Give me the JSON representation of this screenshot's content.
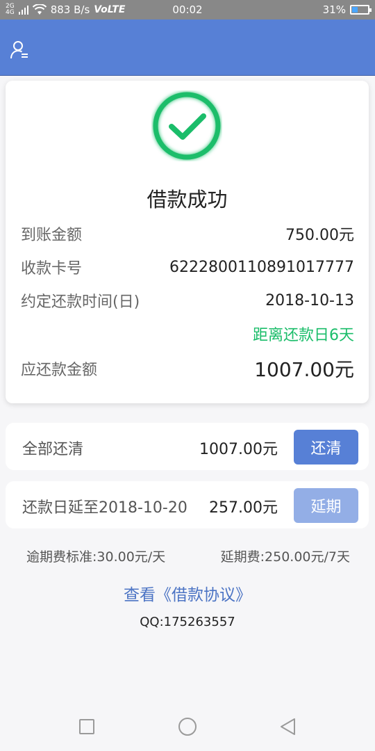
{
  "status_bar": {
    "signal_top": "2G",
    "signal_bottom": "4G",
    "speed": "883 B/s",
    "network": "VoLTE",
    "time": "00:02",
    "battery": "31%"
  },
  "header": {
    "icon": "user-icon",
    "accent_color": "#5780d6"
  },
  "result": {
    "title": "借款成功",
    "icon": "check-circle-icon",
    "icon_color": "#1bbd6a",
    "rows": [
      {
        "label": "到账金额",
        "value": "750.00元"
      },
      {
        "label": "收款卡号",
        "value": "6222800110891017777"
      },
      {
        "label": "约定还款时间(日)",
        "value": "2018-10-13"
      }
    ],
    "remaining_days_text": "距离还款日6天",
    "due_label": "应还款金额",
    "due_value": "1007.00元"
  },
  "actions": {
    "clear": {
      "label": "全部还清",
      "amount": "1007.00元",
      "button": "还清"
    },
    "extend": {
      "label": "还款日延至2018-10-20",
      "amount": "257.00元",
      "button": "延期"
    }
  },
  "fees": {
    "overdue": "逾期费标准:30.00元/天",
    "extension": "延期费:250.00元/7天"
  },
  "agreement_link": "查看《借款协议》",
  "qq": "QQ:175263557",
  "navbar": {
    "items": [
      "square-icon",
      "circle-icon",
      "back-triangle-icon"
    ]
  }
}
